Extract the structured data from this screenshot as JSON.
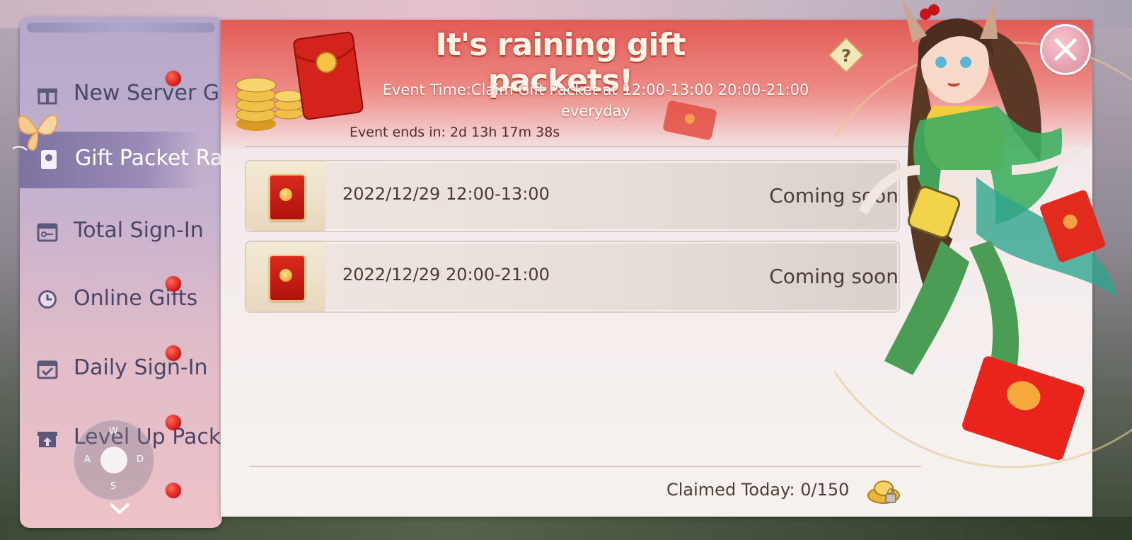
{
  "sidebar": {
    "items": [
      {
        "label": "New Server Gift",
        "icon": "gift-box-icon",
        "dot": true
      },
      {
        "label": "Gift Packet Rain",
        "icon": "red-envelope-icon",
        "dot": false,
        "active": true
      },
      {
        "label": "Total Sign-In",
        "icon": "calendar-key-icon",
        "dot": false
      },
      {
        "label": "Online Gifts",
        "icon": "clock-icon",
        "dot": true
      },
      {
        "label": "Daily Sign-In",
        "icon": "calendar-check-icon",
        "dot": true
      },
      {
        "label": "Level Up Pack",
        "icon": "gift-arrow-icon",
        "dot": true
      }
    ]
  },
  "joystick": {
    "up": "W",
    "left": "A",
    "right": "D",
    "down": "S"
  },
  "banner": {
    "title": "It's raining gift packets!",
    "event_time_line1": "Event Time:Claim Gift Packet at 12:00-13:00 20:00-21:00",
    "event_time_line2": "everyday",
    "event_ends": "Event ends in: 2d 13h 17m 38s"
  },
  "rows": [
    {
      "time": "2022/12/29 12:00-13:00",
      "status": "Coming soon"
    },
    {
      "time": "2022/12/29 20:00-21:00",
      "status": "Coming soon"
    }
  ],
  "footer": {
    "claimed": "Claimed Today: 0/150"
  },
  "help": {
    "glyph": "?"
  },
  "colors": {
    "accent_red": "#d92a1e",
    "title_text": "#fff5e6",
    "sidebar_active": "#8c7daf"
  }
}
